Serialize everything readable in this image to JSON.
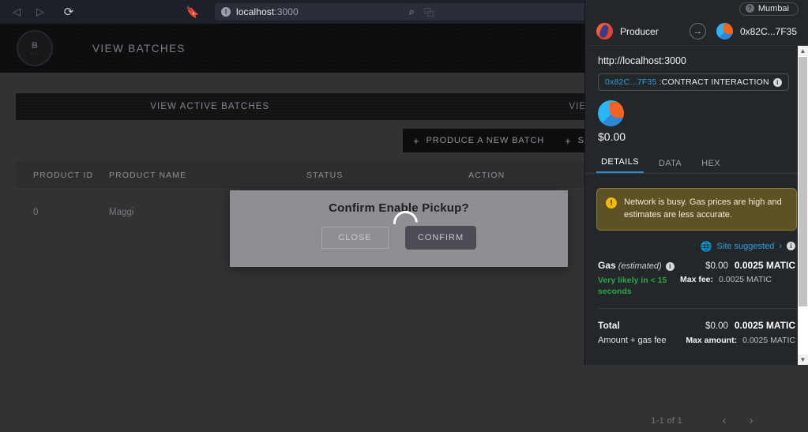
{
  "browser": {
    "back_icon": "back-arrow-icon",
    "forward_icon": "forward-arrow-icon",
    "reload_icon": "reload-icon",
    "bookmark_icon": "bookmark-icon",
    "url_host": "localhost",
    "url_port": ":3000",
    "site_info_icon": "!",
    "search_icon": "search-icon",
    "extension_icon": "extension-icon"
  },
  "app": {
    "logo_text": "B",
    "logo_sub": "• • •",
    "title": "VIEW BATCHES",
    "tabs": [
      {
        "label": "VIEW ACTIVE BATCHES"
      },
      {
        "label": "VIEW SOLD"
      }
    ],
    "actions": [
      {
        "plus": "+",
        "label": "PRODUCE A NEW BATCH"
      },
      {
        "plus": "+",
        "label": "SCAN QR"
      }
    ],
    "table": {
      "columns": [
        "PRODUCT ID",
        "PRODUCT NAME",
        "STATUS",
        "ACTION"
      ],
      "rows": [
        {
          "product_id": "0",
          "product_name": "Maggi",
          "status": "",
          "action": ""
        }
      ]
    },
    "pagination": {
      "label": "1-1 of 1",
      "prev_icon": "‹",
      "next_icon": "›"
    }
  },
  "modal": {
    "title": "Confirm Enable Pickup?",
    "close_label": "CLOSE",
    "confirm_label": "CONFIRM",
    "spinner": "loading-spinner"
  },
  "metamask": {
    "network": {
      "label": "Mumbai",
      "dot_icon": "?"
    },
    "accounts": {
      "from_name": "Producer",
      "from_avatar": "account-identicon",
      "arrow_icon": "→",
      "to_address": "0x82C...7F35",
      "to_avatar": "recipient-identicon"
    },
    "origin": "http://localhost:3000",
    "contract": {
      "address": "0x82C...7F35",
      "separator": " : ",
      "label": "CONTRACT INTERACTION",
      "info_icon": "i"
    },
    "amount": {
      "token_icon": "token-identicon",
      "value": "$0.00"
    },
    "tabs": [
      {
        "label": "DETAILS",
        "active": true
      },
      {
        "label": "DATA",
        "active": false
      },
      {
        "label": "HEX",
        "active": false
      }
    ],
    "warning": {
      "icon": "!",
      "text": "Network is busy. Gas prices are high and estimates are less accurate."
    },
    "site_suggested": {
      "globe_icon": "globe-icon",
      "label": "Site suggested",
      "chevron": "›",
      "info_icon": "i"
    },
    "gas": {
      "label": "Gas",
      "estimated": "(estimated)",
      "info_icon": "i",
      "usd": "$0.00",
      "native": "0.0025 MATIC",
      "eta": "Very likely in < 15 seconds",
      "max_fee_label": "Max fee:",
      "max_fee_value": "0.0025 MATIC"
    },
    "total": {
      "label": "Total",
      "usd": "$0.00",
      "native": "0.0025 MATIC",
      "sub_label": "Amount + gas fee",
      "max_amount_label": "Max amount:",
      "max_amount_value": "0.0025 MATIC"
    },
    "scrollbar": {
      "up": "▲",
      "down": "▼"
    }
  },
  "colors": {
    "accent_blue": "#29a0e0",
    "warning_bg": "#5c5226",
    "success_green": "#28a745",
    "metamask_bg": "#24272a"
  }
}
